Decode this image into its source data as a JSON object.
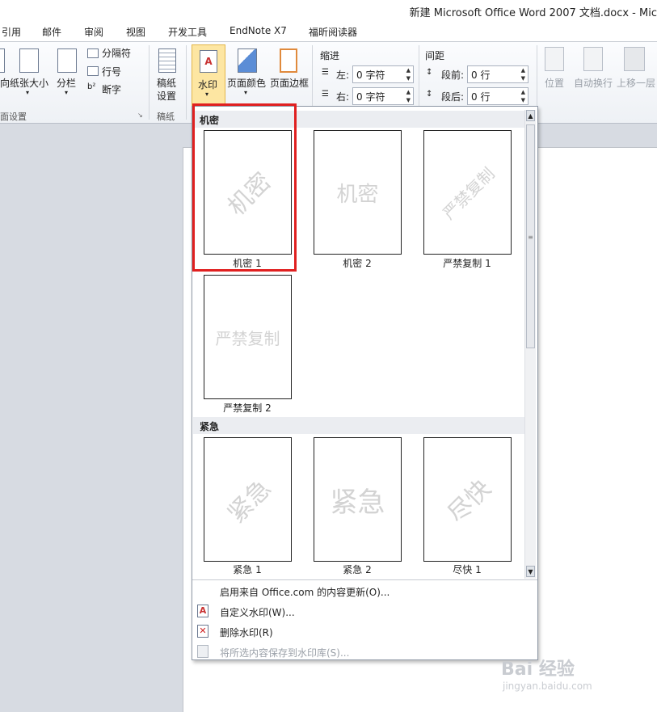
{
  "window": {
    "title": "新建 Microsoft Office Word 2007 文档.docx - Mic"
  },
  "tabs": [
    "引用",
    "邮件",
    "审阅",
    "视图",
    "开发工具",
    "EndNote X7",
    "福昕阅读器"
  ],
  "ribbon": {
    "page_setup": {
      "margins_label": "向",
      "paper_size": "纸张大小",
      "columns": "分栏",
      "breaks": "分隔符",
      "line_numbers": "行号",
      "hyphenation": "断字",
      "group_label": "面设置"
    },
    "manuscript": {
      "label_line1": "稿纸",
      "label_line2": "设置",
      "group_label": "稿纸"
    },
    "background": {
      "watermark": "水印",
      "page_color": "页面颜色",
      "page_borders": "页面边框"
    },
    "indent": {
      "title": "缩进",
      "left_label": "左:",
      "left_value": "0 字符",
      "right_label": "右:",
      "right_value": "0 字符"
    },
    "spacing": {
      "title": "间距",
      "before_label": "段前:",
      "before_value": "0 行",
      "after_label": "段后:",
      "after_value": "0 行"
    },
    "arrange": {
      "position": "位置",
      "wrap_text": "自动换行",
      "bring_forward": "上移一层"
    }
  },
  "gallery": {
    "sections": [
      {
        "title": "机密",
        "items": [
          {
            "caption": "机密 1",
            "watermark": "机密",
            "style": "diagonal"
          },
          {
            "caption": "机密 2",
            "watermark": "机密",
            "style": "horizontal"
          },
          {
            "caption": "严禁复制 1",
            "watermark": "严禁复制",
            "style": "diagonal"
          },
          {
            "caption": "严禁复制 2",
            "watermark": "严禁复制",
            "style": "horizontal"
          }
        ]
      },
      {
        "title": "紧急",
        "items": [
          {
            "caption": "紧急 1",
            "watermark": "紧急",
            "style": "diagonal"
          },
          {
            "caption": "紧急 2",
            "watermark": "紧急",
            "style": "horizontal"
          },
          {
            "caption": "尽快 1",
            "watermark": "尽快",
            "style": "diagonal"
          }
        ]
      }
    ],
    "menu": [
      {
        "label": "启用来自 Office.com 的内容更新(O)...",
        "icon": "none",
        "enabled": true
      },
      {
        "label": "自定义水印(W)...",
        "icon": "custom-watermark-icon",
        "enabled": true
      },
      {
        "label": "删除水印(R)",
        "icon": "remove-watermark-icon",
        "enabled": true
      },
      {
        "label": "将所选内容保存到水印库(S)...",
        "icon": "save-watermark-icon",
        "enabled": false
      }
    ]
  },
  "watermark_site": {
    "brand": "Bai 经验",
    "url": "jingyan.baidu.com"
  },
  "colors": {
    "highlight": "#e02020",
    "selected_button": "#fde6a2"
  }
}
